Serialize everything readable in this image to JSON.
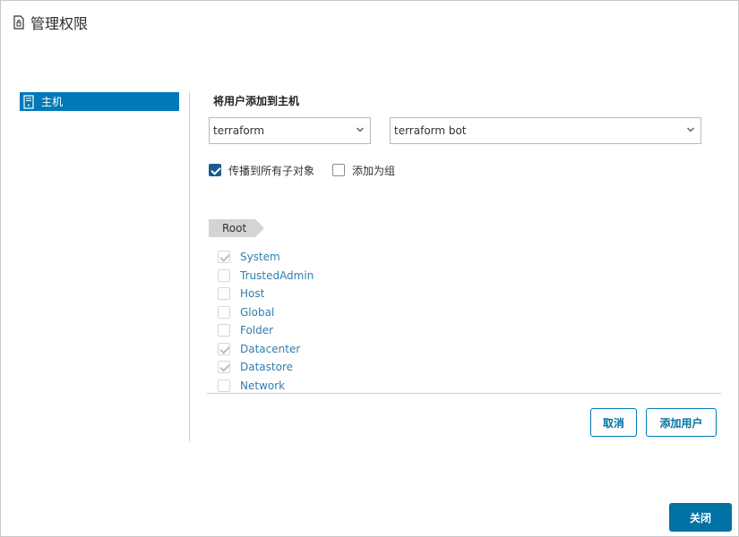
{
  "dialog": {
    "title": "管理权限",
    "icon": "file-lock-icon"
  },
  "sidebar": {
    "items": [
      {
        "label": "主机",
        "icon": "host-icon",
        "selected": true
      }
    ]
  },
  "form": {
    "section_title": "将用户添加到主机",
    "domain_select": {
      "value": "terraform"
    },
    "user_select": {
      "value": "terraform bot"
    },
    "propagate": {
      "label": "传播到所有子对象",
      "checked": true
    },
    "add_as_group": {
      "label": "添加为组",
      "checked": false
    }
  },
  "breadcrumb": {
    "root": "Root"
  },
  "roles": [
    {
      "label": "System",
      "checked": true,
      "disabled": true
    },
    {
      "label": "TrustedAdmin",
      "checked": false,
      "disabled": true
    },
    {
      "label": "Host",
      "checked": false,
      "disabled": true
    },
    {
      "label": "Global",
      "checked": false,
      "disabled": true
    },
    {
      "label": "Folder",
      "checked": false,
      "disabled": true
    },
    {
      "label": "Datacenter",
      "checked": true,
      "disabled": true
    },
    {
      "label": "Datastore",
      "checked": true,
      "disabled": true
    },
    {
      "label": "Network",
      "checked": false,
      "disabled": true
    }
  ],
  "buttons": {
    "cancel": "取消",
    "add_user": "添加用户",
    "close": "关闭"
  },
  "colors": {
    "accent": "#0079b8",
    "primary_button": "#0072a3",
    "link": "#2f7fae",
    "checkbox": "#1c5a8e"
  }
}
